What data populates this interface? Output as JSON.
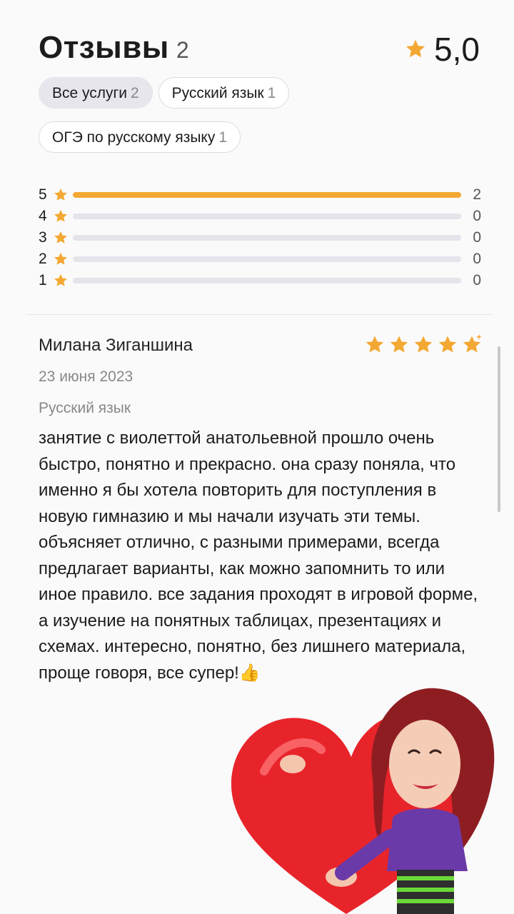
{
  "header": {
    "title": "Отзывы",
    "count": "2",
    "rating": "5,0"
  },
  "filters": [
    {
      "label": "Все услуги",
      "count": "2",
      "active": true
    },
    {
      "label": "Русский язык",
      "count": "1",
      "active": false
    },
    {
      "label": "ОГЭ по русскому языку",
      "count": "1",
      "active": false
    }
  ],
  "distribution": [
    {
      "stars": "5",
      "count": "2",
      "fraction": 1.0
    },
    {
      "stars": "4",
      "count": "0",
      "fraction": 0
    },
    {
      "stars": "3",
      "count": "0",
      "fraction": 0
    },
    {
      "stars": "2",
      "count": "0",
      "fraction": 0
    },
    {
      "stars": "1",
      "count": "0",
      "fraction": 0
    }
  ],
  "review": {
    "author": "Милана Зиганшина",
    "date": "23 июня 2023",
    "subject": "Русский язык",
    "rating": 5,
    "text": "занятие с виолеттой анатольевной прошло очень быстро, понятно и прекрасно. она сразу поняла, что именно я бы хотела повторить для поступления в новую гимназию и мы начали изучать эти темы. объясняет отлично, с разными примерами, всегда предлагает варианты, как можно запомнить то или иное правило. все задания проходят в игровой форме, а изучение на понятных таблицах, презентациях и схемах. интересно, понятно, без лишнего материала, проще говоря, все супер!👍"
  },
  "colors": {
    "star": "#f3a833",
    "track": "#e4e4ea",
    "heart": "#e8242b"
  },
  "icons": {
    "star": "star-icon",
    "sticker": "heart-sticker"
  }
}
